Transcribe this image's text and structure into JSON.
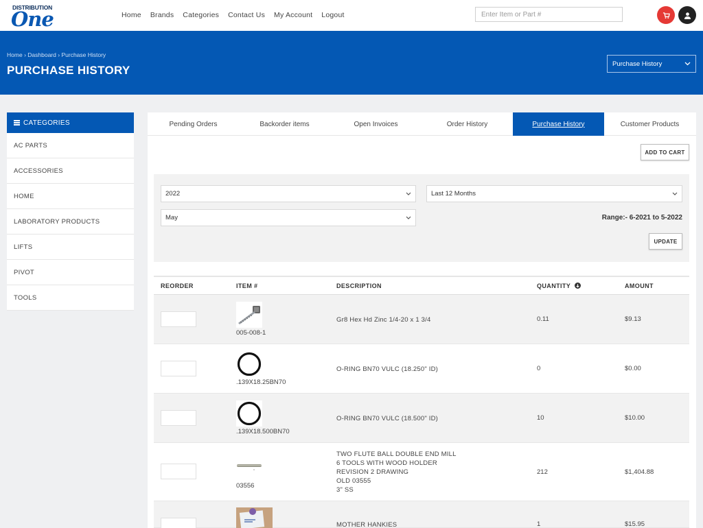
{
  "logo": {
    "line1": "DISTRIBUTION",
    "line2": "One"
  },
  "nav": [
    "Home",
    "Brands",
    "Categories",
    "Contact Us",
    "My Account",
    "Logout"
  ],
  "search": {
    "placeholder": "Enter Item or Part #"
  },
  "colors": {
    "brand": "#0458b4",
    "cart": "#e53935"
  },
  "breadcrumb": [
    "Home",
    "Dashboard",
    "Purchase History"
  ],
  "breadcrumb_sep": "›",
  "page": {
    "title": "PURCHASE HISTORY",
    "selector": "Purchase History"
  },
  "sidebar": {
    "heading": "CATEGORIES",
    "items": [
      "AC PARTS",
      "ACCESSORIES",
      "HOME",
      "LABORATORY PRODUCTS",
      "LIFTS",
      "PIVOT",
      "TOOLS"
    ]
  },
  "tabs": [
    "Pending Orders",
    "Backorder items",
    "Open Invoices",
    "Order History",
    "Purchase History",
    "Customer Products"
  ],
  "active_tab": "Purchase History",
  "buttons": {
    "add_to_cart": "ADD TO CART",
    "update": "UPDATE"
  },
  "filters": {
    "year": "2022",
    "period": "Last 12 Months",
    "month": "May",
    "range": "Range:- 6-2021 to 5-2022"
  },
  "table": {
    "headers": {
      "reorder": "REORDER",
      "item": "ITEM #",
      "description": "DESCRIPTION",
      "quantity": "QUANTITY",
      "amount": "AMOUNT"
    },
    "rows": [
      {
        "item": "005-008-1",
        "description": [
          "Gr8 Hex Hd Zinc 1/4-20 x 1 3/4"
        ],
        "quantity": "0.11",
        "amount": "$9.13",
        "image": "bolt"
      },
      {
        "item": ".139X18.25BN70",
        "description": [
          "O-RING BN70 VULC (18.250\" ID)"
        ],
        "quantity": "0",
        "amount": "$0.00",
        "image": "o-ring"
      },
      {
        "item": ".139X18.500BN70",
        "description": [
          "O-RING BN70 VULC (18.500\" ID)"
        ],
        "quantity": "10",
        "amount": "$10.00",
        "image": "o-ring"
      },
      {
        "item": "03556",
        "description": [
          "TWO FLUTE BALL DOUBLE END MILL",
          "6 TOOLS WITH WOOD HOLDER",
          "REVISION 2 DRAWING",
          "OLD 03555",
          "3\" SS"
        ],
        "quantity": "212",
        "amount": "$1,404.88",
        "image": "end-mill"
      },
      {
        "item": "",
        "description": [
          "MOTHER HANKIES"
        ],
        "quantity": "1",
        "amount": "$15.95",
        "image": "hankies"
      }
    ]
  }
}
